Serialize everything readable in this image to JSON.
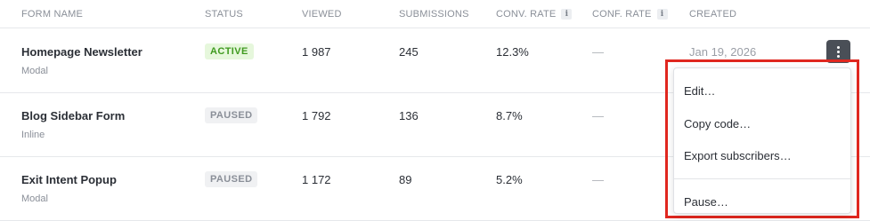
{
  "table": {
    "columns": [
      "FORM NAME",
      "STATUS",
      "VIEWED",
      "SUBMISSIONS",
      "CONV. RATE",
      "CONF. RATE",
      "CREATED"
    ],
    "info_glyph": "i",
    "rows": [
      {
        "name": "Homepage Newsletter",
        "type": "Modal",
        "status": "ACTIVE",
        "viewed": "1 987",
        "submissions": "245",
        "conv_rate": "12.3%",
        "conf_rate": "—",
        "created": "Jan 19, 2026"
      },
      {
        "name": "Blog Sidebar Form",
        "type": "Inline",
        "status": "PAUSED",
        "viewed": "1 792",
        "submissions": "136",
        "conv_rate": "8.7%",
        "conf_rate": "—"
      },
      {
        "name": "Exit Intent Popup",
        "type": "Modal",
        "status": "PAUSED",
        "viewed": "1 172",
        "submissions": "89",
        "conv_rate": "5.2%",
        "conf_rate": "—"
      }
    ]
  },
  "context_menu": {
    "items": [
      "Edit…",
      "Copy code…",
      "Export subscribers…",
      "Pause…"
    ]
  },
  "icons": {
    "row_actions": "more-vertical-icon",
    "info": "info-icon"
  },
  "colors": {
    "active_badge_bg": "#e6f7dc",
    "active_badge_text": "#3f9a1f",
    "paused_badge_bg": "#f0f1f3",
    "highlight_outline": "#e0271f",
    "kebab_bg": "#4a4f57"
  }
}
